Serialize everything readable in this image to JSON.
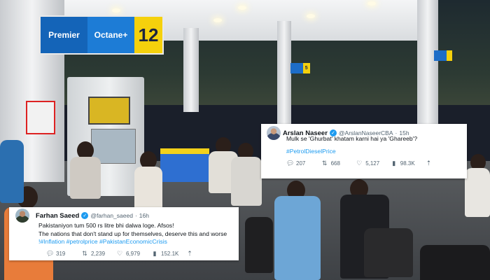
{
  "photo": {
    "sign_brand_1": "Premier",
    "sign_brand_2": "Octane+",
    "sign_number": "12",
    "mini_sign_number": "5"
  },
  "tweets": [
    {
      "display_name": "Arslan Naseer",
      "handle": "@ArslanNaseerCBA",
      "time": "15h",
      "text": "Mulk se 'Ghurbat' khatam karni hai ya 'Ghareeb'?",
      "hashtags": "#PetrolDieselPrice",
      "replies": "207",
      "retweets": "668",
      "likes": "5,127",
      "views": "98.3K"
    },
    {
      "display_name": "Farhan Saeed",
      "handle": "@farhan_saeed",
      "time": "16h",
      "text_line_1": "Pakistaniyon tum 500 rs litre bhi dalwa loge. Afsos!",
      "text_line_2": "The nations that don't stand up for themselves, deserve this and worse",
      "hashtags": "!#Inflation #petrolprice #PakistanEconomicCrisis",
      "replies": "319",
      "retweets": "2,239",
      "likes": "6,979",
      "views": "152.1K"
    }
  ],
  "colors": {
    "link": "#1d9bf0",
    "verified": "#1d9bf0",
    "muted": "#536471",
    "text": "#0f1419"
  },
  "icons": [
    "verified-badge-icon",
    "reply-icon",
    "retweet-icon",
    "like-icon",
    "views-icon",
    "share-icon"
  ]
}
